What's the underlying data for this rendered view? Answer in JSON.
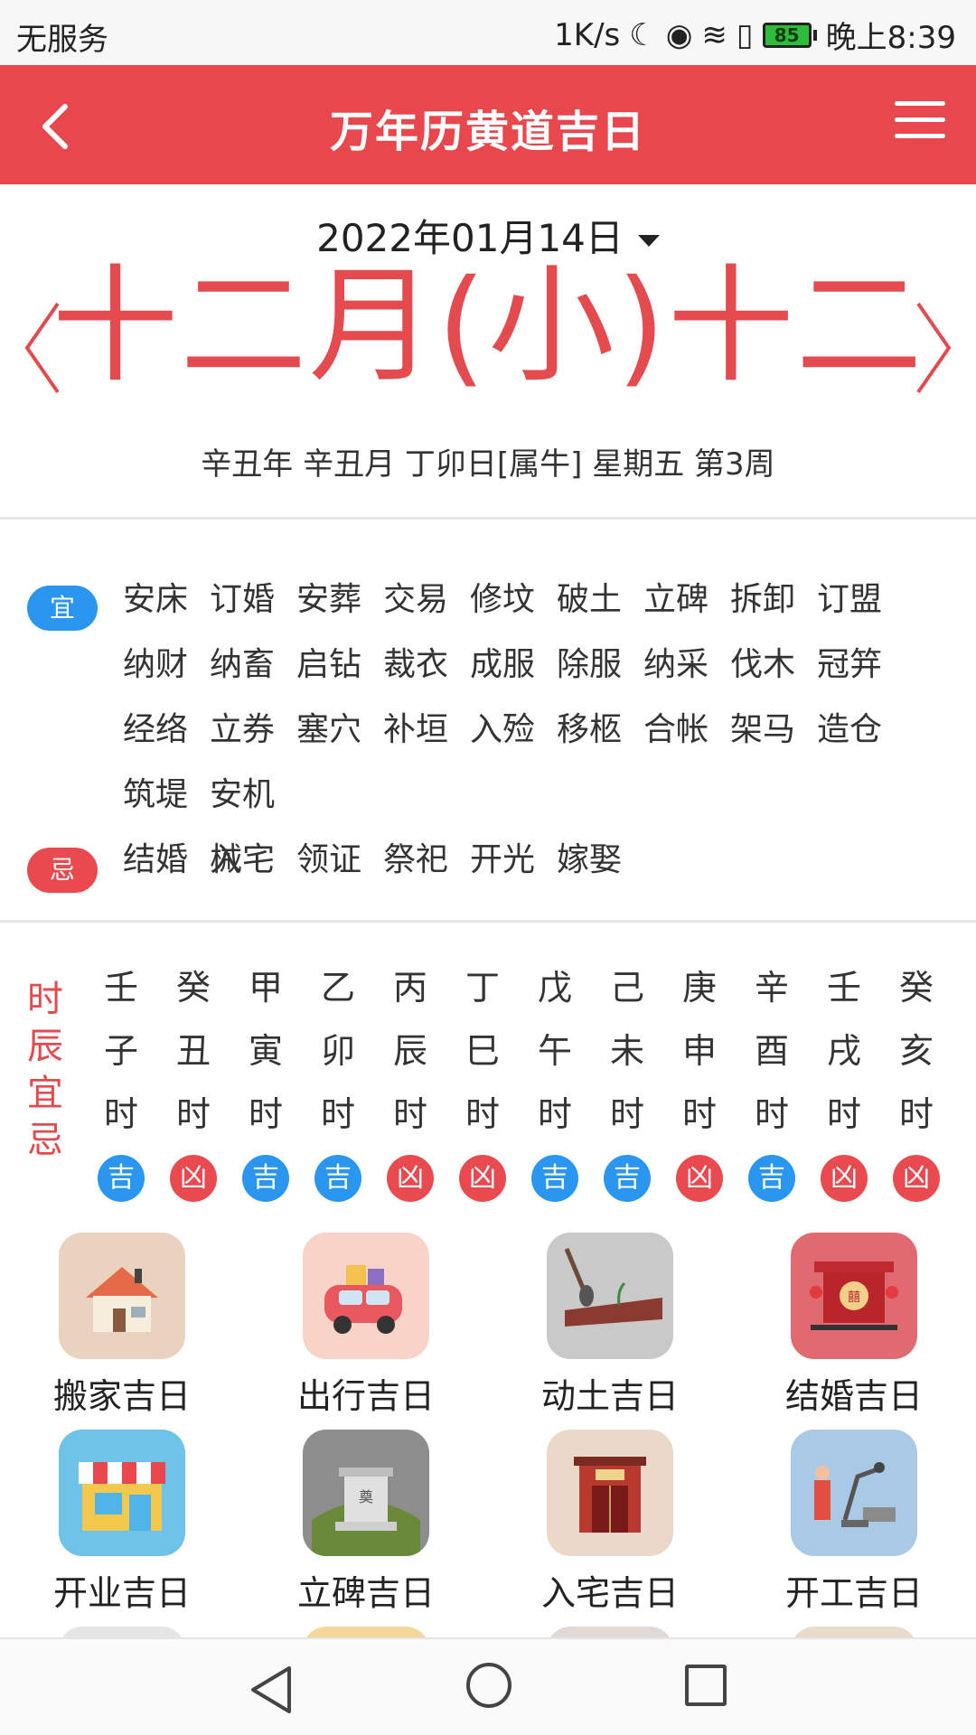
{
  "status": {
    "carrier": "无服务",
    "speed": "1K/s",
    "battery": "85",
    "time": "晚上8:39"
  },
  "header": {
    "title": "万年历黄道吉日"
  },
  "date": {
    "solar": "2022年01月14日",
    "lunar": "十二月(小)十二",
    "ganzhi": "辛丑年 辛丑月 丁卯日[属牛] 星期五 第3周"
  },
  "yi": {
    "label": "宜",
    "items": [
      "安床",
      "订婚",
      "安葬",
      "交易",
      "修坟",
      "破土",
      "立碑",
      "拆卸",
      "订盟",
      "纳财",
      "纳畜",
      "启钻",
      "裁衣",
      "成服",
      "除服",
      "纳采",
      "伐木",
      "冠笄",
      "经络",
      "立券",
      "塞穴",
      "补垣",
      "入殓",
      "移柩",
      "合帐",
      "架马",
      "造仓",
      "筑堤",
      "安机械"
    ]
  },
  "ji": {
    "label": "忌",
    "items": [
      "结婚",
      "入宅",
      "领证",
      "祭祀",
      "开光",
      "嫁娶"
    ]
  },
  "shichen": {
    "label": [
      "时",
      "辰",
      "宜",
      "忌"
    ],
    "columns": [
      {
        "stem": "壬",
        "branch": "子",
        "hour": "时",
        "status": "吉",
        "good": true
      },
      {
        "stem": "癸",
        "branch": "丑",
        "hour": "时",
        "status": "凶",
        "good": false
      },
      {
        "stem": "甲",
        "branch": "寅",
        "hour": "时",
        "status": "吉",
        "good": true
      },
      {
        "stem": "乙",
        "branch": "卯",
        "hour": "时",
        "status": "吉",
        "good": true
      },
      {
        "stem": "丙",
        "branch": "辰",
        "hour": "时",
        "status": "凶",
        "good": false
      },
      {
        "stem": "丁",
        "branch": "巳",
        "hour": "时",
        "status": "凶",
        "good": false
      },
      {
        "stem": "戊",
        "branch": "午",
        "hour": "时",
        "status": "吉",
        "good": true
      },
      {
        "stem": "己",
        "branch": "未",
        "hour": "时",
        "status": "吉",
        "good": true
      },
      {
        "stem": "庚",
        "branch": "申",
        "hour": "时",
        "status": "凶",
        "good": false
      },
      {
        "stem": "辛",
        "branch": "酉",
        "hour": "时",
        "status": "吉",
        "good": true
      },
      {
        "stem": "壬",
        "branch": "戌",
        "hour": "时",
        "status": "凶",
        "good": false
      },
      {
        "stem": "癸",
        "branch": "亥",
        "hour": "时",
        "status": "凶",
        "good": false
      }
    ]
  },
  "categories": [
    {
      "label": "搬家吉日",
      "icon": "house-icon",
      "bg": "#e9d3bf"
    },
    {
      "label": "出行吉日",
      "icon": "car-icon",
      "bg": "#f9d2c8"
    },
    {
      "label": "动土吉日",
      "icon": "shovel-icon",
      "bg": "#c9c9c9"
    },
    {
      "label": "结婚吉日",
      "icon": "wedding-sedan-icon",
      "bg": "#e06a6f"
    },
    {
      "label": "开业吉日",
      "icon": "shop-icon",
      "bg": "#6fc2e8"
    },
    {
      "label": "立碑吉日",
      "icon": "tombstone-icon",
      "bg": "#8d8d8d"
    },
    {
      "label": "入宅吉日",
      "icon": "gate-icon",
      "bg": "#ead8c8"
    },
    {
      "label": "开工吉日",
      "icon": "factory-icon",
      "bg": "#a9c9e4"
    }
  ],
  "colors": {
    "primary": "#e8484d",
    "good": "#2a96f0",
    "bad": "#e84a4f"
  }
}
